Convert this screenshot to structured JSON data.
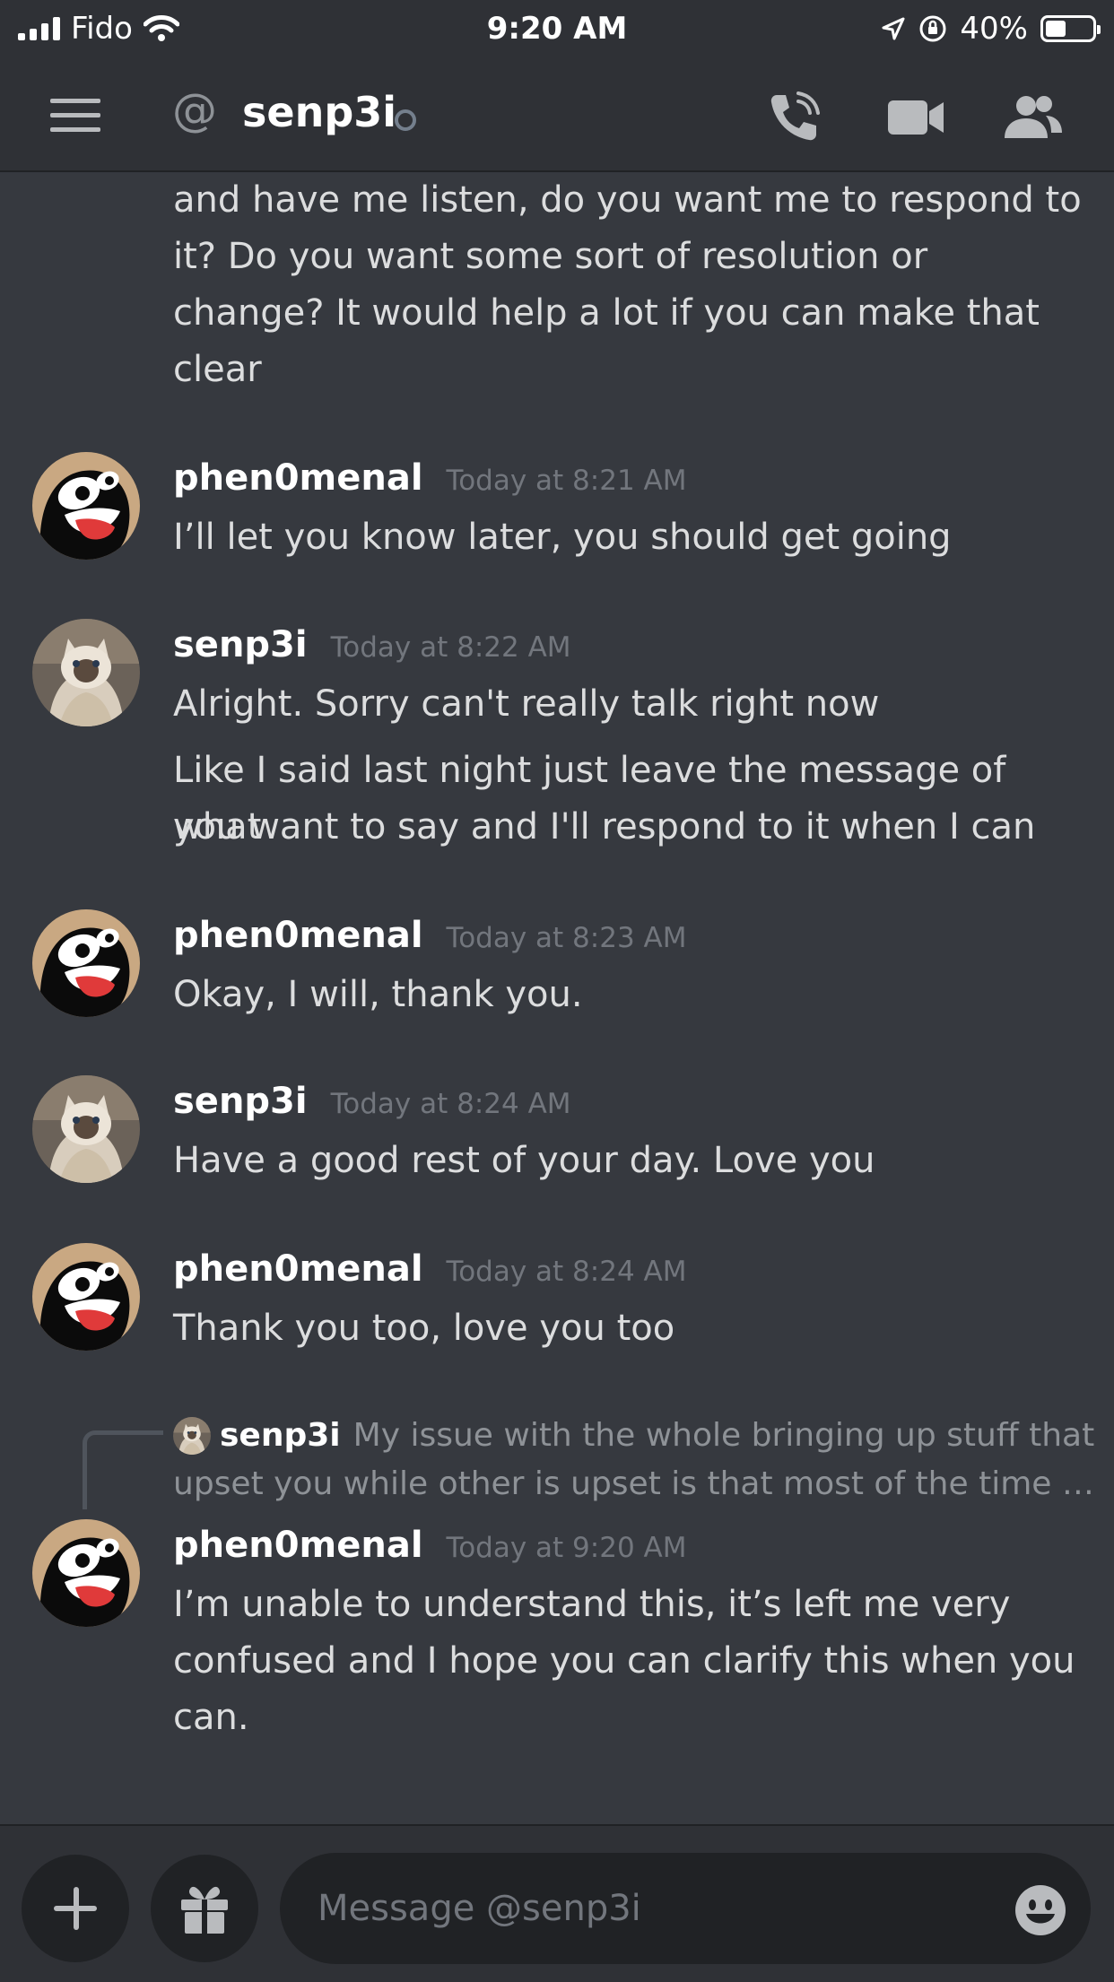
{
  "status_bar": {
    "carrier": "Fido",
    "time": "9:20 AM",
    "battery": "40%"
  },
  "header": {
    "recipient": "senp3i",
    "at_symbol": "@"
  },
  "partial_message": {
    "lines": [
      "and have me listen, do you want me to respond to",
      "it? Do you want some sort of resolution or",
      "change? It would help a lot if you can make that",
      "clear"
    ]
  },
  "messages": [
    {
      "author": "phen0menal",
      "timestamp": "Today at 8:21 AM",
      "lines": [
        "I’ll let you know later, you should get going"
      ]
    },
    {
      "author": "senp3i",
      "timestamp": "Today at 8:22 AM",
      "lines": [
        "Alright. Sorry can't really talk right now"
      ],
      "followup": [
        "Like I said last night just leave the message of what",
        "you want to say and I'll respond to it when I can"
      ]
    },
    {
      "author": "phen0menal",
      "timestamp": "Today at 8:23 AM",
      "lines": [
        "Okay, I will, thank you."
      ]
    },
    {
      "author": "senp3i",
      "timestamp": "Today at 8:24 AM",
      "lines": [
        "Have a good rest of your day. Love you"
      ]
    },
    {
      "author": "phen0menal",
      "timestamp": "Today at 8:24 AM",
      "lines": [
        "Thank you too, love you too"
      ]
    },
    {
      "author": "phen0menal",
      "timestamp": "Today at 9:20 AM",
      "lines": [
        "I’m unable to understand this, it’s left me very",
        "confused and I hope you can clarify this when you",
        "can."
      ]
    }
  ],
  "reply_preview": {
    "author": "senp3i",
    "text": "My issue with the whole bringing up stuff that upset you while other is upset is that most of the time …"
  },
  "composer": {
    "placeholder": "Message @senp3i"
  },
  "colors": {
    "background": "#36393f",
    "header": "#2f3136",
    "input": "#202225",
    "timestamp": "#72767d",
    "accent_red": "#e03a3a"
  }
}
